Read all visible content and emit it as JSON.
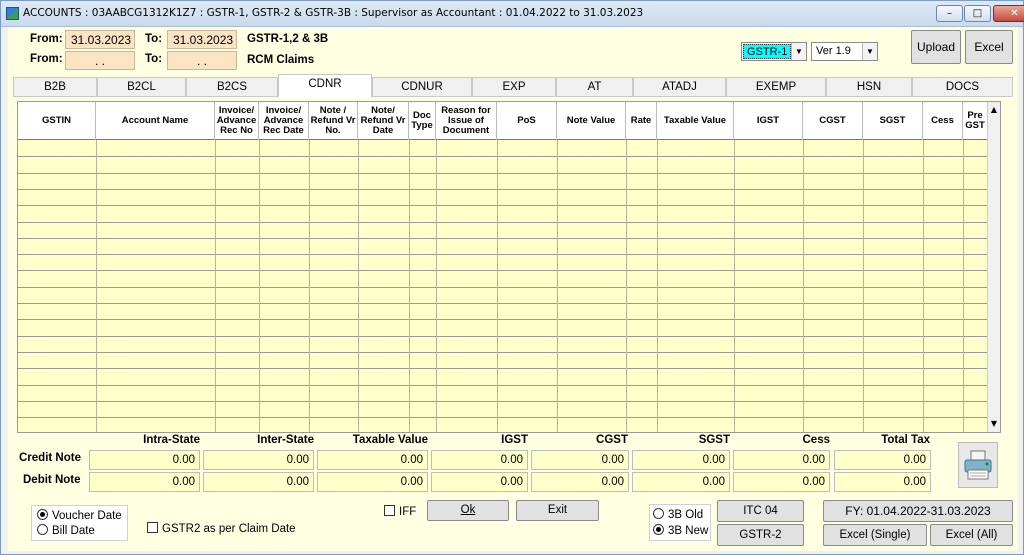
{
  "window": {
    "title": "ACCOUNTS : 03AABCG1312K1Z7 : GSTR-1, GSTR-2 & GSTR-3B : Supervisor as Accountant : 01.04.2022 to 31.03.2023",
    "minimize": "–",
    "maximize": "□",
    "close": "✕"
  },
  "dates": {
    "from_label_1": "From:",
    "from_value_1": "31.03.2023",
    "to_label_1": "To:",
    "to_value_1": "31.03.2023",
    "caption_1": "GSTR-1,2 & 3B",
    "from_label_2": "From:",
    "from_value_2": ". .",
    "to_label_2": "To:",
    "to_value_2": ". .",
    "caption_2": "RCM Claims"
  },
  "toolbar": {
    "return_type": "GSTR-1",
    "version": "Ver 1.9",
    "upload_label": "Upload",
    "excel_label": "Excel"
  },
  "tabs": [
    "B2B",
    "B2CL",
    "B2CS",
    "CDNR",
    "CDNUR",
    "EXP",
    "AT",
    "ATADJ",
    "EXEMP",
    "HSN",
    "DOCS"
  ],
  "active_tab": "CDNR",
  "grid": {
    "columns": [
      "GSTIN",
      "Account Name",
      "Invoice/ Advance Rec No",
      "Invoice/ Advance Rec Date",
      "Note / Refund Vr No.",
      "Note/ Refund Vr Date",
      "Doc Type",
      "Reason for Issue of Document",
      "PoS",
      "Note Value",
      "Rate",
      "Taxable Value",
      "IGST",
      "CGST",
      "SGST",
      "Cess",
      "Pre GST"
    ],
    "row_count": 18
  },
  "totals": {
    "headers": [
      "Intra-State",
      "Inter-State",
      "Taxable Value",
      "IGST",
      "CGST",
      "SGST",
      "Cess",
      "Total Tax"
    ],
    "credit_note_label": "Credit Note",
    "debit_note_label": "Debit Note",
    "credit_note": [
      "0.00",
      "0.00",
      "0.00",
      "0.00",
      "0.00",
      "0.00",
      "0.00",
      "0.00"
    ],
    "debit_note": [
      "0.00",
      "0.00",
      "0.00",
      "0.00",
      "0.00",
      "0.00",
      "0.00",
      "0.00"
    ]
  },
  "bottom": {
    "voucher_date": "Voucher Date",
    "bill_date": "Bill Date",
    "gstr2_claim": "GSTR2 as per Claim Date",
    "iff": "IFF",
    "ok": "Ok",
    "exit": "Exit",
    "old_3b": "3B Old",
    "new_3b": "3B New",
    "itc04": "ITC 04",
    "gstr2": "GSTR-2",
    "fy": "FY: 01.04.2022-31.03.2023",
    "excel_single": "Excel (Single)",
    "excel_all": "Excel (All)"
  },
  "colors": {
    "grid_fill": "#ffffc9",
    "date_fill": "#fbe3c3",
    "combo_highlight": "#00ffff"
  }
}
